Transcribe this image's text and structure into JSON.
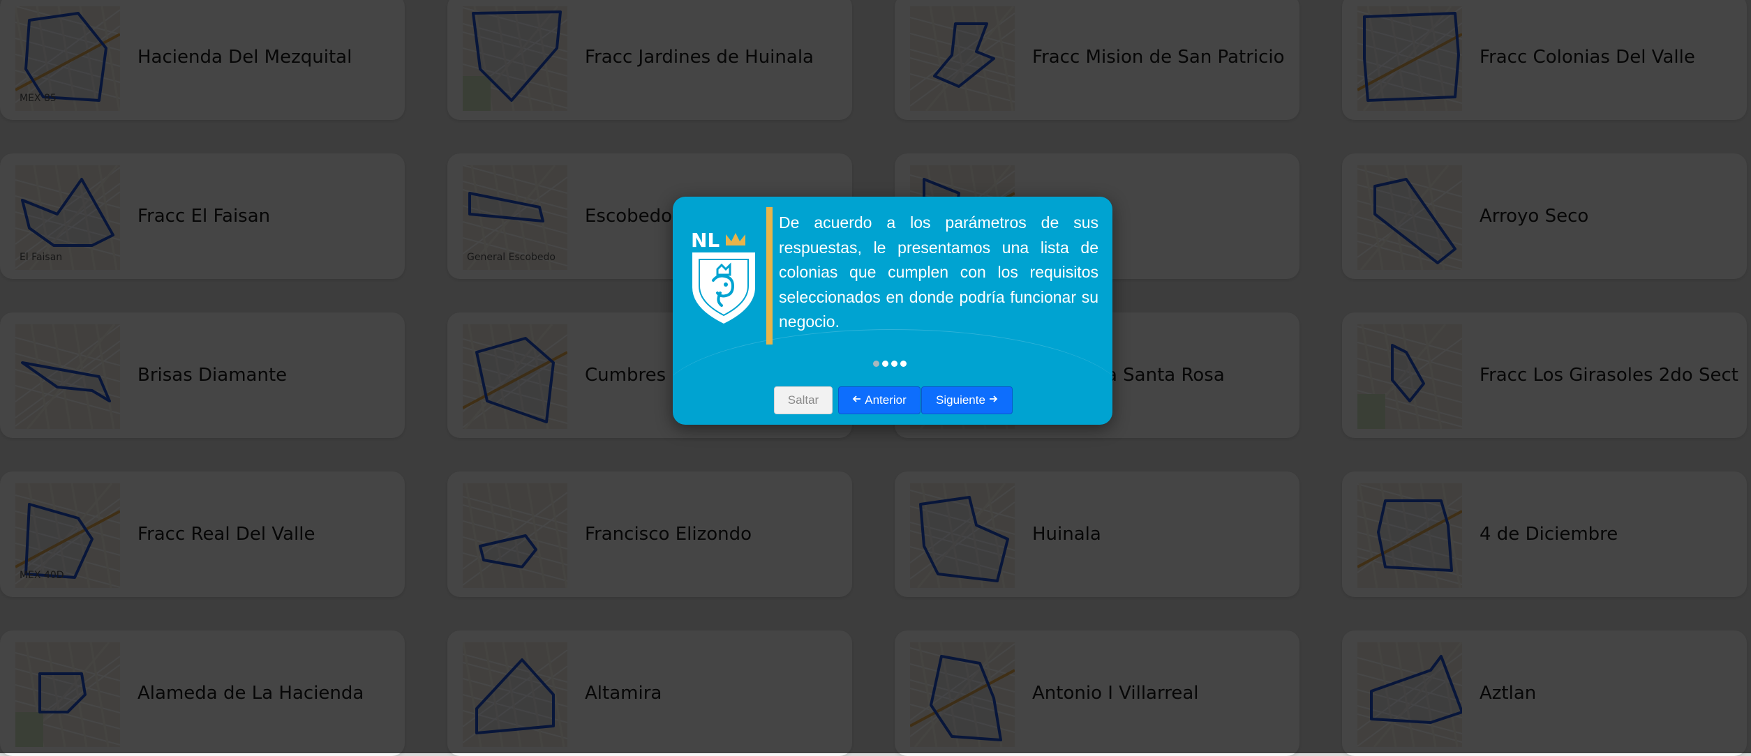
{
  "cards": [
    {
      "label": "Hacienda Del Mezquital",
      "map_text": "MEX 85"
    },
    {
      "label": "Fracc Jardines de Huinala"
    },
    {
      "label": "Fracc Mision de San Patricio"
    },
    {
      "label": "Fracc Colonias Del Valle"
    },
    {
      "label": "Fracc El Faisan",
      "map_text": "El Faisan"
    },
    {
      "label": "Escobedo",
      "map_text": "General Escobedo"
    },
    {
      "label": ""
    },
    {
      "label": "Arroyo Seco"
    },
    {
      "label": "Brisas Diamante"
    },
    {
      "label": "Cumbres M"
    },
    {
      "label": "Hacienda Santa Rosa"
    },
    {
      "label": "Fracc Los Girasoles 2do Sect"
    },
    {
      "label": "Fracc Real Del Valle",
      "map_text": "MEX 40D"
    },
    {
      "label": "Francisco Elizondo"
    },
    {
      "label": "Huinala"
    },
    {
      "label": "4 de Diciembre"
    },
    {
      "label": "Alameda de La Hacienda"
    },
    {
      "label": "Altamira"
    },
    {
      "label": "Antonio I Villarreal"
    },
    {
      "label": "Aztlan"
    }
  ],
  "modal": {
    "logo_text": "NL",
    "message": "De acuerdo a los parámetros de sus respuestas, le presentamos una lista de colonias que cumplen con los requisitos seleccionados en donde podría funcionar su negocio.",
    "dots_total": 4,
    "dots_active_index": 0,
    "skip_label": "Saltar",
    "prev_label": "Anterior",
    "next_label": "Siguiente"
  },
  "colors": {
    "modal_bg": "#00a3d1",
    "accent_bar": "#e8b44a",
    "primary_button": "#0d6efd",
    "polygon_stroke": "#1f4fd1"
  },
  "icons": {
    "prev_arrow": "arrow-left-icon",
    "next_arrow": "arrow-right-icon",
    "logo": "nl-shield-logo-icon"
  }
}
